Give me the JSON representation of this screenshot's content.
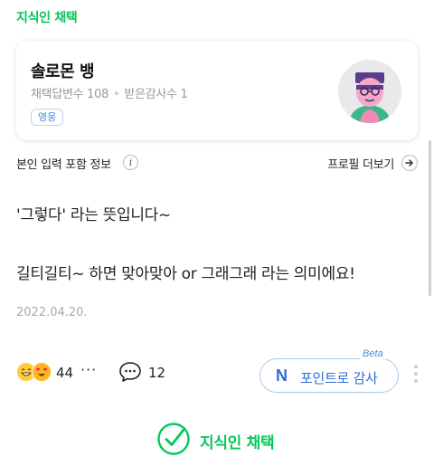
{
  "header": {
    "title": "지식인 채택"
  },
  "profile": {
    "name": "솔로몬 뱅",
    "adopted_label": "채택답변수 108",
    "thanks_label": "받은감사수 1",
    "badge": "영웅"
  },
  "info": {
    "included_label": "본인 입력 포함 정보",
    "info_icon": "i",
    "more_profile_label": "프로필 더보기"
  },
  "answer": {
    "line1": "'그렇다' 라는 뜻입니다~",
    "line2": "길티길티~ 하면 맞아맞아 or 그래그래 라는 의미에요!",
    "date": "2022.04.20."
  },
  "actions": {
    "reaction_count": "44",
    "more_label": "···",
    "comment_count": "12",
    "point_icon": "N",
    "point_label": "포인트로 감사",
    "beta_label": "Beta"
  },
  "footer": {
    "adopt_label": "지식인 채택"
  },
  "colors": {
    "brand_green": "#03c75a",
    "point_blue": "#2f6cd5",
    "badge_blue": "#4a8bd6"
  }
}
